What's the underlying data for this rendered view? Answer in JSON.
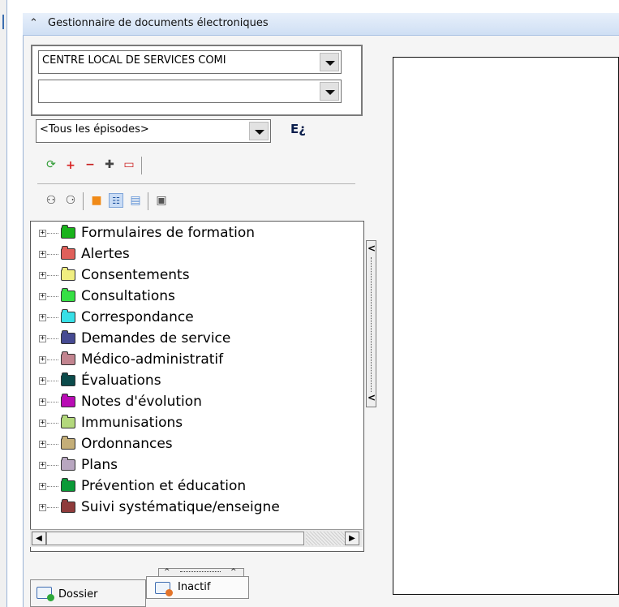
{
  "header": {
    "title": "Gestionnaire de documents électroniques",
    "collapse_icon": "chevron-double-up-icon"
  },
  "filters": {
    "establishment_value": "CENTRE LOCAL DE SERVICES COMI",
    "second_value": "",
    "episodes_value": "<Tous les épisodes>",
    "episodes_label": "E¿"
  },
  "toolbar_row1": [
    "refresh-icon",
    "add-icon",
    "remove-icon",
    "add-subitem-icon",
    "remove-subitem-icon"
  ],
  "toolbar_row2": [
    "binoculars-icon",
    "binoculars-filter-icon",
    "folder-view-icon",
    "tree-view-icon",
    "list-view-icon",
    "print-icon"
  ],
  "tree": {
    "items": [
      {
        "label": "Formulaires de formation",
        "color": "#19b31b"
      },
      {
        "label": "Alertes",
        "color": "#e0605a"
      },
      {
        "label": "Consentements",
        "color": "#f0ee80"
      },
      {
        "label": "Consultations",
        "color": "#35e044"
      },
      {
        "label": "Correspondance",
        "color": "#37dfe6"
      },
      {
        "label": "Demandes de service",
        "color": "#464a92"
      },
      {
        "label": "Médico-administratif",
        "color": "#c2848f"
      },
      {
        "label": "Évaluations",
        "color": "#0b4b4b"
      },
      {
        "label": "Notes d'évolution",
        "color": "#b80cb4"
      },
      {
        "label": "Immunisations",
        "color": "#b3d87c"
      },
      {
        "label": "Ordonnances",
        "color": "#c4ae78"
      },
      {
        "label": "Plans",
        "color": "#b8a6c0"
      },
      {
        "label": "Prévention et éducation",
        "color": "#0a9a37"
      },
      {
        "label": "Suivi systématique/enseigne",
        "color": "#8f3b3b"
      }
    ]
  },
  "tabs": [
    {
      "label": "Dossier",
      "badge_color": "#2da83a"
    },
    {
      "label": "Inactif",
      "badge_color": "#e3742a"
    }
  ]
}
